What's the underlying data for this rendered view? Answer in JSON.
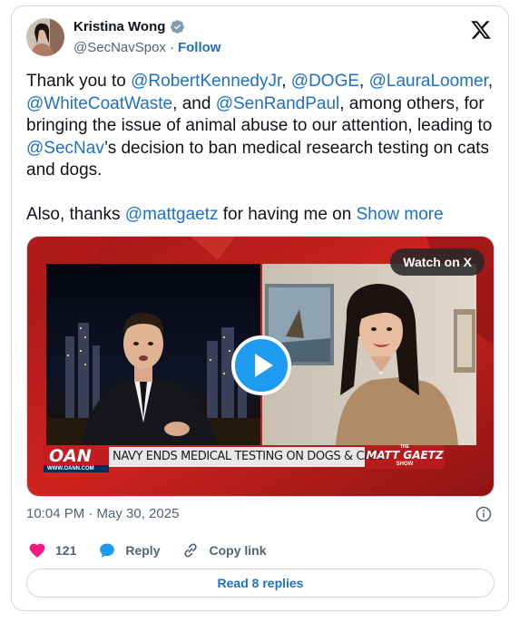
{
  "author": {
    "name": "Kristina Wong",
    "handle": "@SecNavSpox",
    "separator": "·",
    "follow_label": "Follow"
  },
  "tweet": {
    "segments": [
      {
        "text": "Thank you to ",
        "type": "text"
      },
      {
        "text": "@RobertKennedyJr",
        "type": "mention"
      },
      {
        "text": ", ",
        "type": "text"
      },
      {
        "text": "@DOGE",
        "type": "mention"
      },
      {
        "text": ", ",
        "type": "text"
      },
      {
        "text": "@LauraLoomer",
        "type": "mention"
      },
      {
        "text": ", ",
        "type": "text"
      },
      {
        "text": "@WhiteCoatWaste",
        "type": "mention"
      },
      {
        "text": ", and ",
        "type": "text"
      },
      {
        "text": "@SenRandPaul",
        "type": "mention"
      },
      {
        "text": ", among others, for bringing the issue of animal abuse to our attention, leading to ",
        "type": "text"
      },
      {
        "text": "@SecNav",
        "type": "mention"
      },
      {
        "text": "’s decision to ban medical research testing on cats and dogs.",
        "type": "text"
      }
    ],
    "second_line_prefix": "Also, thanks ",
    "second_line_mention": "@mattgaetz",
    "second_line_suffix": " for having me on ",
    "show_more": "Show more"
  },
  "media": {
    "watch_label": "Watch on X",
    "chyron_network": "OAN",
    "chyron_site": "WWW.OANN.COM",
    "chyron_text": "NAVY ENDS MEDICAL TESTING ON DOGS & CATS",
    "show_logo_top": "THE",
    "show_logo_main": "MATT GAETZ",
    "show_logo_bottom": "SHOW"
  },
  "meta": {
    "timestamp": "10:04 PM · May 30, 2025"
  },
  "actions": {
    "likes": "121",
    "reply_label": "Reply",
    "copy_label": "Copy link"
  },
  "read_replies_label": "Read 8 replies",
  "colors": {
    "link": "#1d71c4",
    "heart": "#f91880",
    "reply": "#1d9bf0",
    "border": "#cfd9de",
    "muted": "#536471"
  }
}
